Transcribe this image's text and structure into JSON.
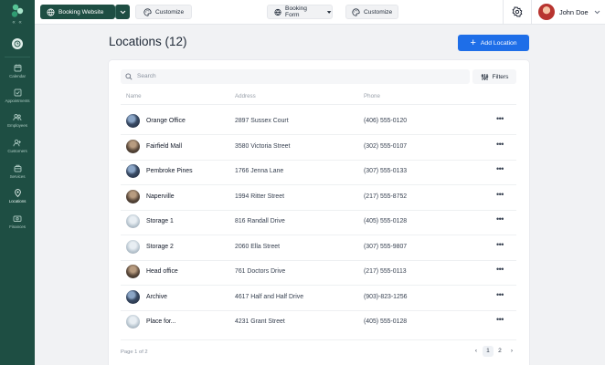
{
  "sidebar": {
    "collapse_label": "« «",
    "items": [
      {
        "label": "Calendar",
        "icon": "calendar-icon"
      },
      {
        "label": "Appointments",
        "icon": "appointments-icon"
      },
      {
        "label": "Employees",
        "icon": "employees-icon"
      },
      {
        "label": "Customers",
        "icon": "customers-icon"
      },
      {
        "label": "Services",
        "icon": "services-icon"
      },
      {
        "label": "Locations",
        "icon": "location-pin-icon"
      },
      {
        "label": "Finances",
        "icon": "finances-icon"
      }
    ]
  },
  "topbar": {
    "booking_website_label": "Booking Website",
    "customize_label_1": "Customize",
    "booking_form_label": "Booking Form",
    "customize_label_2": "Customize",
    "user_name": "John Doe"
  },
  "page": {
    "title": "Locations (12)",
    "add_button_label": "Add Location",
    "search_placeholder": "Search",
    "filters_label": "Filters",
    "columns": {
      "name": "Name",
      "address": "Address",
      "phone": "Phone"
    },
    "rows": [
      {
        "name": "Orange Office",
        "address": "2897 Sussex Court",
        "phone": "(406) 555-0120",
        "more": "•••"
      },
      {
        "name": "Fairfield Mall",
        "address": "3580 Victoria Street",
        "phone": "(302) 555-0107",
        "more": "•••"
      },
      {
        "name": "Pembroke Pines",
        "address": "1766 Jenna Lane",
        "phone": "(307) 555-0133",
        "more": "•••"
      },
      {
        "name": "Naperville",
        "address": "1994 Ritter Street",
        "phone": "(217) 555-8752",
        "more": "•••"
      },
      {
        "name": "Storage 1",
        "address": "816 Randall Drive",
        "phone": "(405) 555-0128",
        "more": "•••"
      },
      {
        "name": "Storage 2",
        "address": "2060 Ella Street",
        "phone": "(307) 555-9807",
        "more": "•••"
      },
      {
        "name": "Head office",
        "address": "761 Doctors Drive",
        "phone": "(217) 555-0113",
        "more": "•••"
      },
      {
        "name": "Archive",
        "address": "4617 Half and Half Drive",
        "phone": "(903)-823-1256",
        "more": "•••"
      },
      {
        "name": "Place for...",
        "address": "4231 Grant Street",
        "phone": "(405) 555-0128",
        "more": "•••"
      }
    ],
    "pagination": {
      "text": "Page 1 of 2",
      "prev": "‹",
      "page1": "1",
      "page2": "2",
      "next": "›"
    }
  },
  "colors": {
    "sidebar": "#1e4e43",
    "primary": "#1e6ee8",
    "background": "#f1f2f4"
  }
}
